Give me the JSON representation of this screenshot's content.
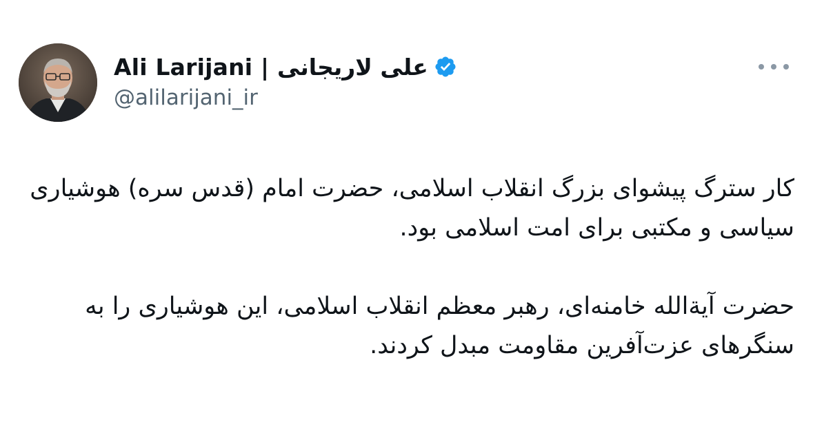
{
  "author": {
    "display_name": "Ali Larijani | علی لاریجانی",
    "handle": "@alilarijani_ir",
    "verified": true,
    "avatar_icon": "profile-photo",
    "verified_color": "#1d9bf0"
  },
  "menu": {
    "icon": "more-horizontal-icon"
  },
  "tweet": {
    "paragraphs": [
      "کار سترگ پیشوای بزرگ انقلاب اسلامی، حضرت امام (قدس سره) هوشیاری سیاسی و مکتبی برای امت اسلامی بود.",
      "حضرت آیةالله خامنه‌ای، رهبر معظم انقلاب اسلامی، این هوشیاری را به سنگرهای عزت‌آفرین مقاومت مبدل کردند."
    ]
  },
  "colors": {
    "text": "#0f1419",
    "secondary": "#536471",
    "accent": "#1d9bf0"
  }
}
